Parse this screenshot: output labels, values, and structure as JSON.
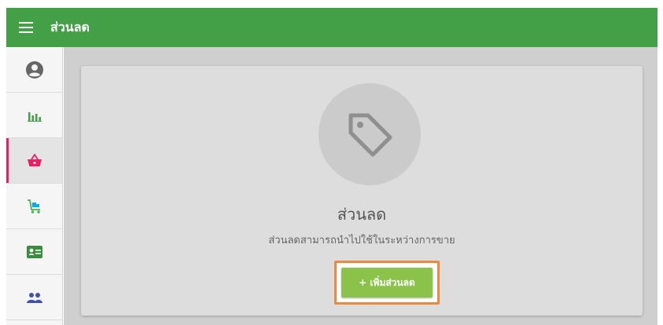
{
  "appbar": {
    "title": "ส่วนลด",
    "color": "#43a047"
  },
  "sidebar": {
    "items": [
      {
        "icon": "account-circle-icon",
        "color": "#666666"
      },
      {
        "icon": "bar-chart-icon",
        "color": "#43a047"
      },
      {
        "icon": "basket-icon",
        "color": "#e91e63",
        "active": true
      },
      {
        "icon": "cart-icon",
        "color": "#03a9f4"
      },
      {
        "icon": "id-card-icon",
        "color": "#388e3c"
      },
      {
        "icon": "people-icon",
        "color": "#3f51b5"
      }
    ],
    "active_color": "#e91e63"
  },
  "empty_state": {
    "icon": "tag-icon",
    "title": "ส่วนลด",
    "subtitle": "ส่วนลดสามารถนำไปใช้ในระหว่างการขาย",
    "button_label": "+ เพิ่มส่วนลด",
    "button_color": "#8bc34a",
    "highlight_color": "#f0883a"
  }
}
